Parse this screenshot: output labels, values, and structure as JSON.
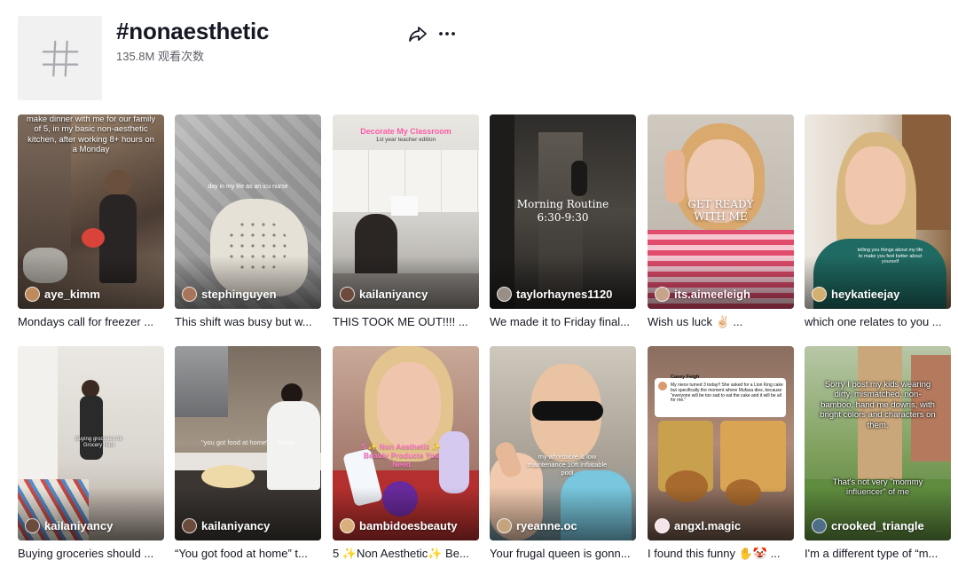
{
  "hashtag": {
    "title": "#nonaesthetic",
    "views": "135.8M 观看次数"
  },
  "icons": {
    "hashtag": "hashtag-icon",
    "share": "share-arrow-icon",
    "more": "more-dots-icon"
  },
  "videos": [
    {
      "author": "aye_kimm",
      "caption": "Mondays call for freezer ...",
      "overlay": "make dinner with me for our family of 5, in my basic non-aesthetic kitchen, after working 8+ hours on a Monday"
    },
    {
      "author": "stephinguyen",
      "caption": "This shift was busy but w...",
      "overlay": "day in my life as an icu nurse"
    },
    {
      "author": "kailaniyancy",
      "caption": "THIS TOOK ME OUT!!!! ...",
      "overlay": "Decorate My Classroom",
      "overlay_sub": "1st year teacher edition"
    },
    {
      "author": "taylorhaynes1120",
      "caption": "We made it to Friday final...",
      "overlay": "Morning Routine",
      "overlay_sub": "6:30-9:30"
    },
    {
      "author": "its.aimeeleigh",
      "caption": "Wish us luck ✌🏻 ...",
      "overlay": "GET READY WITH ME"
    },
    {
      "author": "heykatieejay",
      "caption": "which one relates to you ...",
      "overlay": "telling you things about my life to make you feel better about yourself"
    },
    {
      "author": "kailaniyancy",
      "caption": "Buying groceries should ...",
      "overlay": "Buying groceries for Grocery Haul"
    },
    {
      "author": "kailaniyancy",
      "caption": "“You got food at home” t...",
      "overlay": "\"you got food at home\" ... home"
    },
    {
      "author": "bambidoesbeauty",
      "caption": "5 ✨Non Aesthetic✨ Be...",
      "overlay": "5 ✨ Non Aesthetic ✨ Beauty Products You Need"
    },
    {
      "author": "ryeanne.oc",
      "caption": "Your frugal queen is gonn...",
      "overlay": "my affordable & low maintenance 10ft inflatable pool"
    },
    {
      "author": "angxl.magic",
      "caption": "I found this funny ✋🤡 ...",
      "overlay_tweet_name": "Casey Feigh",
      "overlay": "My niece turned 3 today!! She asked for a Lion King cake but specifically the moment where Mufasa dies, because \"everyone will be too sad to eat the cake and it will be all for me.\""
    },
    {
      "author": "crooked_triangle",
      "caption": "I'm a different type of “m...",
      "overlay": "Sorry I post my kids wearing dirty, mismatched, non-bamboo, hand me downs, with bright colors and characters on them.",
      "overlay_sub": "That's not very \"mommy influencer\" of me"
    }
  ],
  "colors": {
    "text_primary": "#161823",
    "text_secondary": "#5f6068",
    "avatar_bg": "#f1f1f2"
  }
}
